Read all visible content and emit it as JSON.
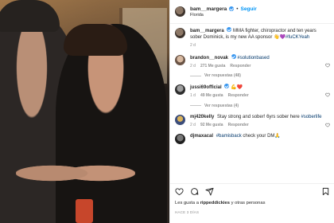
{
  "post": {
    "username": "bam__margera",
    "follow_label": "Seguir",
    "location": "Florida",
    "caption": {
      "username": "bam__margera",
      "text": "MMA fighter, chiropractor and ten years sober Dominick, is my new AA sponsor",
      "emoji": "👋💜",
      "hashtag": "#fuCKYeah",
      "time": "2 d"
    }
  },
  "comments": [
    {
      "username": "brandon__novak",
      "hashtag": "#solutionbased",
      "time": "2 d",
      "likes": "271 Me gusta",
      "reply": "Responder",
      "view_replies": "Ver respuestas (48)"
    },
    {
      "username": "jussi69official",
      "emoji": "💪❤️",
      "time": "1 d",
      "likes": "49 Me gusta",
      "reply": "Responder",
      "view_replies": "Ver respuestas (4)"
    },
    {
      "username": "mj420kelly",
      "text": "Stay strong and sober! 6yrs sober here",
      "hashtag": "#soberlife",
      "time": "2 d",
      "likes": "92 Me gusta",
      "reply": "Responder"
    },
    {
      "username": "djmaxacal",
      "hashtag": "#bamisback",
      "text": "check your DM",
      "emoji": "🙏"
    }
  ],
  "footer": {
    "likes_prefix": "Les gusta a",
    "likes_user": "rippeddickies",
    "likes_suffix": "y otras personas",
    "time_ago": "HACE 3 DÍAS"
  },
  "icons": [
    "heart-icon",
    "comment-icon",
    "share-icon",
    "bookmark-icon",
    "verified-icon"
  ],
  "colors": {
    "link_blue": "#0095f6",
    "verified_blue": "#3897f0",
    "muted": "#8e8e8e"
  }
}
